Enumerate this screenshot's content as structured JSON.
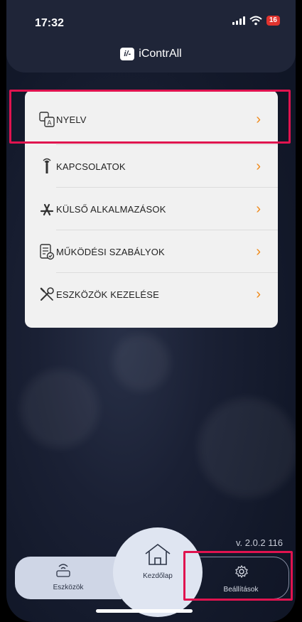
{
  "status": {
    "time": "17:32",
    "battery": "16"
  },
  "header": {
    "app_name": "iContrAll",
    "logo_text": "i/-"
  },
  "menu": {
    "items": [
      {
        "label": "NYELV",
        "icon": "language-icon"
      },
      {
        "label": "KAPCSOLATOK",
        "icon": "antenna-icon"
      },
      {
        "label": "KÜLSŐ ALKALMAZÁSOK",
        "icon": "app-store-icon"
      },
      {
        "label": "MŰKÖDÉSI SZABÁLYOK",
        "icon": "rules-icon"
      },
      {
        "label": "ESZKÖZÖK KEZELÉSE",
        "icon": "tools-icon"
      }
    ],
    "chevron": "›"
  },
  "version": "v. 2.0.2 116",
  "tabbar": {
    "tabs": [
      {
        "label": "Eszközök",
        "icon": "devices-icon"
      },
      {
        "label": "Kezdőlap",
        "icon": "home-icon"
      },
      {
        "label": "Beállítások",
        "icon": "gear-icon"
      }
    ]
  },
  "colors": {
    "accent": "#f08a1a",
    "highlight": "#e0134f",
    "header_bg": "#1f2538"
  }
}
